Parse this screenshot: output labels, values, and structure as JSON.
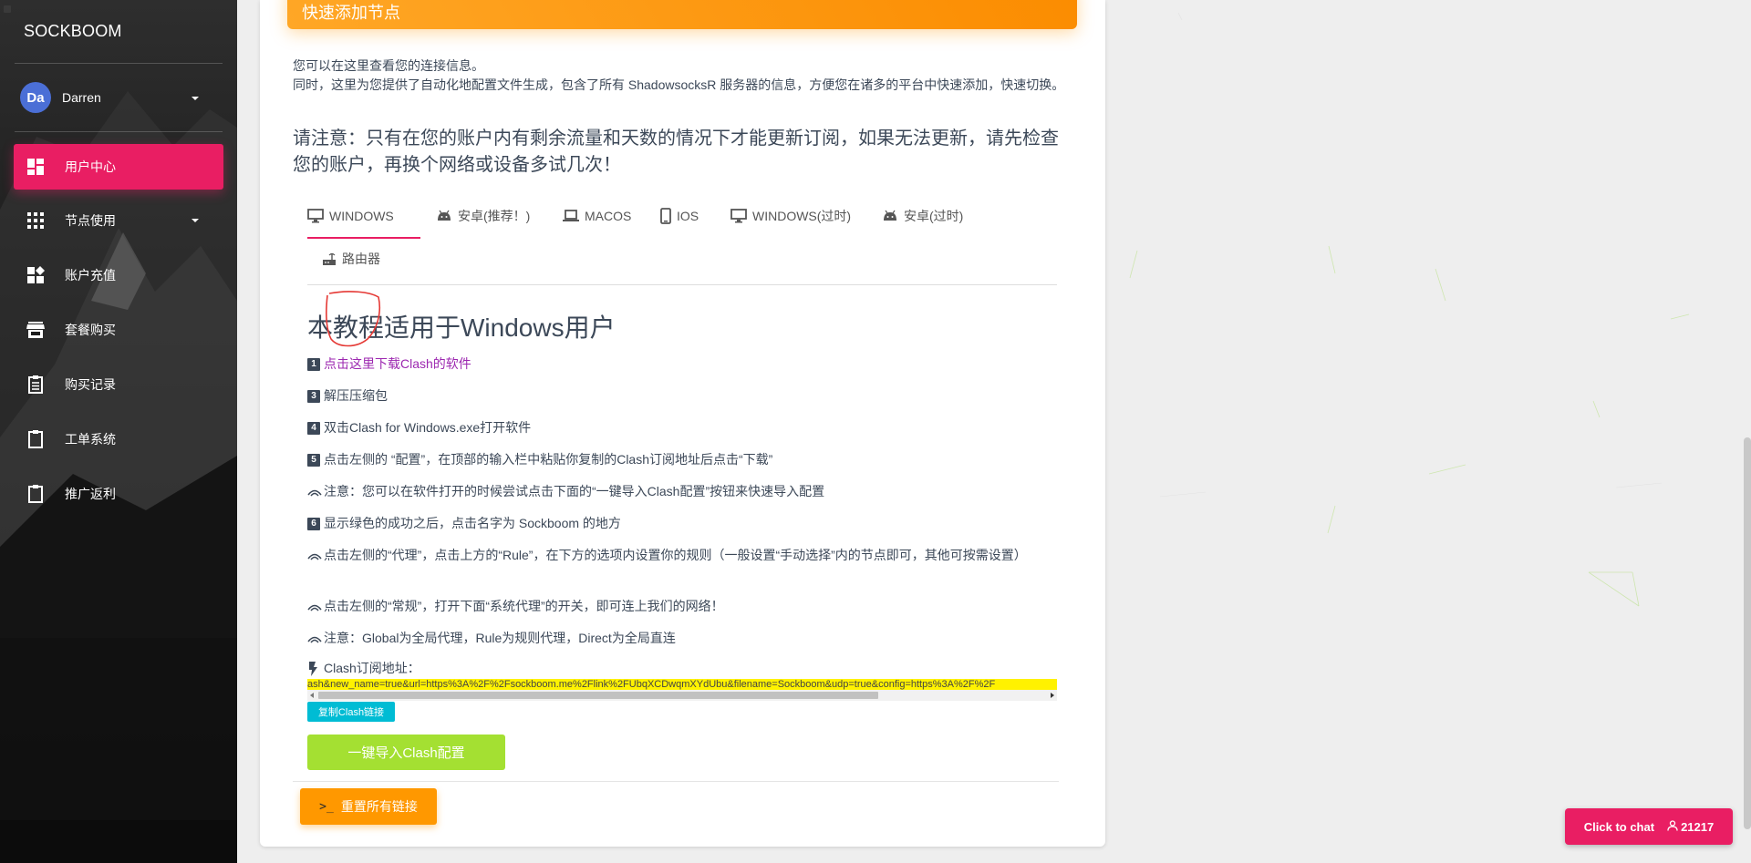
{
  "sidebar": {
    "brand": "SOCKBOOM",
    "user": {
      "initials": "Da",
      "name": "Darren"
    },
    "items": [
      {
        "label": "用户中心",
        "icon": "dashboard-icon",
        "active": true
      },
      {
        "label": "节点使用",
        "icon": "apps-grid-icon",
        "active": false,
        "has_caret": true
      },
      {
        "label": "账户充值",
        "icon": "widgets-icon",
        "active": false
      },
      {
        "label": "套餐购买",
        "icon": "store-icon",
        "active": false
      },
      {
        "label": "购买记录",
        "icon": "receipt-icon",
        "active": false
      },
      {
        "label": "工单系统",
        "icon": "clipboard-icon",
        "active": false
      },
      {
        "label": "推广返利",
        "icon": "clipboard-icon",
        "active": false
      }
    ]
  },
  "card": {
    "header_title": "快速添加节点",
    "intro_line1": "您可以在这里查看您的连接信息。",
    "intro_line2": "同时，这里为您提供了自动化地配置文件生成，包含了所有 ShadowsocksR 服务器的信息，方便您在诸多的平台中快速添加，快速切换。",
    "notice": "请注意：只有在您的账户内有剩余流量和天数的情况下才能更新订阅，如果无法更新，请先检查您的账户，再换个网络或设备多试几次！"
  },
  "tabs": [
    {
      "label": "WINDOWS",
      "icon": "desktop-icon",
      "active": true
    },
    {
      "label": "安卓(推荐！)",
      "icon": "android-icon",
      "active": false
    },
    {
      "label": "MACOS",
      "icon": "laptop-icon",
      "active": false
    },
    {
      "label": "IOS",
      "icon": "phone-icon",
      "active": false
    },
    {
      "label": "WINDOWS(过时)",
      "icon": "desktop-icon",
      "active": false
    },
    {
      "label": "安卓(过时)",
      "icon": "android-icon",
      "active": false
    },
    {
      "label": "路由器",
      "icon": "router-icon",
      "active": false
    }
  ],
  "tutorial": {
    "title": "本教程适用于Windows用户",
    "steps": [
      {
        "marker": "1",
        "text": "点击这里下载Clash的软件",
        "is_link": true
      },
      {
        "marker": "3",
        "text": "解压压缩包"
      },
      {
        "marker": "4",
        "text": "双击Clash for Windows.exe打开软件"
      },
      {
        "marker": "5",
        "text": "点击左侧的 “配置”，在顶部的输入栏中粘贴你复制的Clash订阅地址后点击“下载”"
      },
      {
        "marker": "wifi",
        "text": "注意：您可以在软件打开的时候尝试点击下面的“一键导入Clash配置”按钮来快速导入配置"
      },
      {
        "marker": "6",
        "text": "显示绿色的成功之后，点击名字为 Sockboom 的地方"
      },
      {
        "marker": "wifi",
        "text": "点击左侧的“代理”，点击上方的“Rule”，在下方的选项内设置你的规则（一般设置“手动选择”内的节点即可，其他可按需设置）"
      },
      {
        "marker": "wifi",
        "text": "点击左侧的“常规”，打开下面“系统代理”的开关，即可连上我们的网络！"
      },
      {
        "marker": "wifi",
        "text": "注意：Global为全局代理，Rule为规则代理，Direct为全局直连"
      }
    ],
    "sub_label": "Clash订阅地址：",
    "sub_url": "ash&new_name=true&url=https%3A%2F%2Fsockboom.me%2Flink%2FUbqXCDwqmXYdUbu&filename=Sockboom&udp=true&config=https%3A%2F%2F",
    "copy_button": "复制Clash链接",
    "import_button": "一键导入Clash配置",
    "reset_prompt": ">_",
    "reset_button": "重置所有链接"
  },
  "chat": {
    "label": "Click to chat",
    "count": "21217"
  },
  "colors": {
    "accent": "#e91e63",
    "header": "#fb8c00",
    "import": "#a4e032",
    "copy": "#00bcd4",
    "link": "#9c27b0"
  }
}
